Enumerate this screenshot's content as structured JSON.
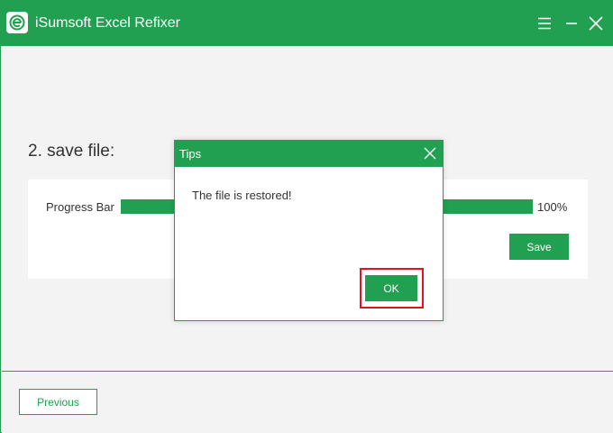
{
  "app": {
    "title": "iSumsoft Excel Refixer",
    "logo_icon": "isumsoft-e-logo",
    "accent_color": "#20a050",
    "highlight_color": "#e0141e"
  },
  "titlebar": {
    "menu_icon": "hamburger-menu-icon",
    "minimize_icon": "minimize-icon",
    "close_icon": "close-icon"
  },
  "step": {
    "title": "2. save file:"
  },
  "progress": {
    "label": "Progress Bar",
    "value_text": "100%",
    "percent": 100
  },
  "card": {
    "save_label": "Save"
  },
  "footer": {
    "previous_label": "Previous"
  },
  "dialog": {
    "title": "Tips",
    "message": "The file is restored!",
    "ok_label": "OK",
    "close_icon": "close-icon"
  }
}
